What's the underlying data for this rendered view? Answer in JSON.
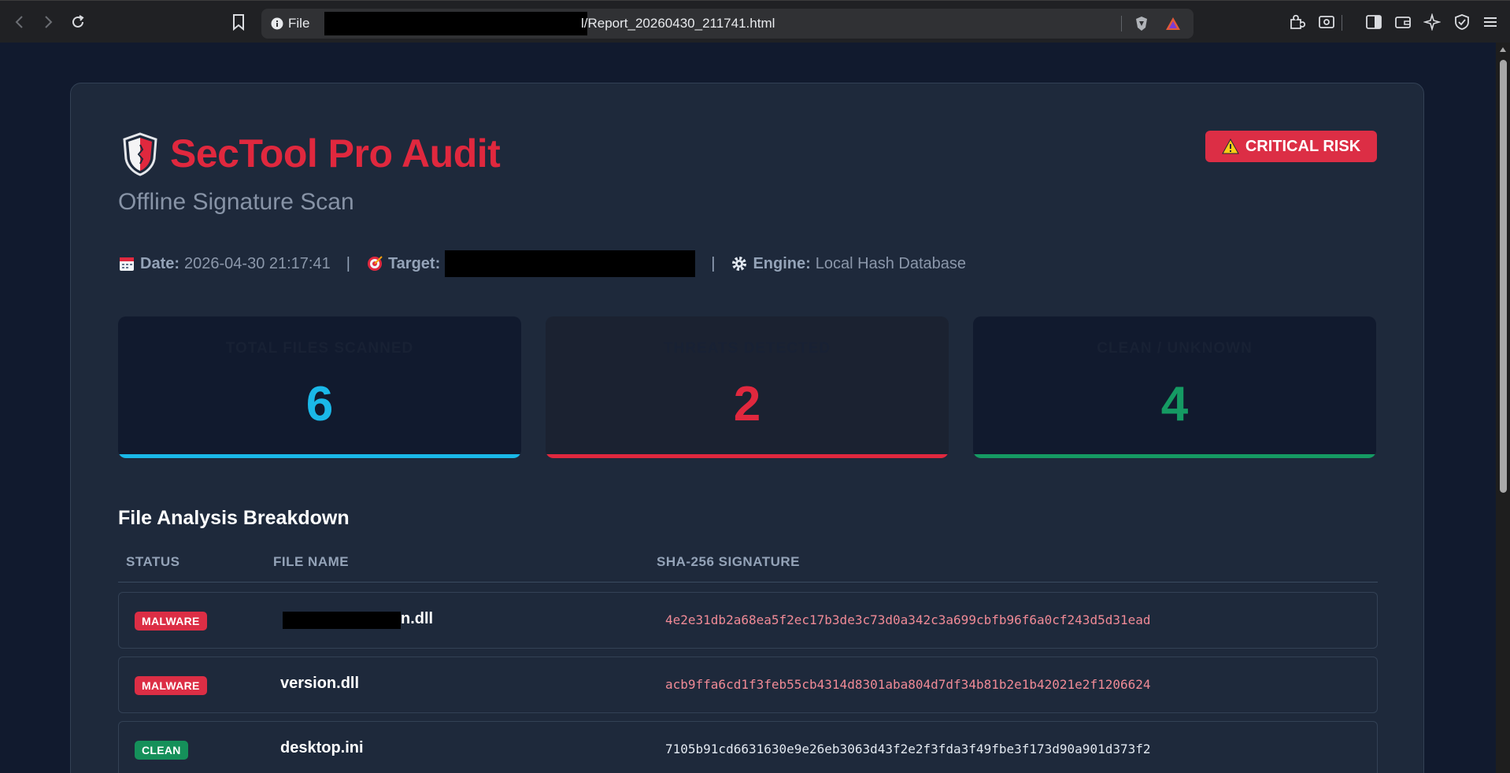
{
  "browser": {
    "url_scheme_label": "File",
    "url_visible": "l/Report_20260430_211741.html"
  },
  "report": {
    "title": "SecTool Pro Audit",
    "subtitle": "Offline Signature Scan",
    "risk_badge": "CRITICAL RISK",
    "meta": {
      "date_label": "Date:",
      "date_value": "2026-04-30 21:17:41",
      "target_label": "Target:",
      "engine_label": "Engine:",
      "engine_value": "Local Hash Database"
    },
    "stats": [
      {
        "label": "Total Files Scanned",
        "value": "6",
        "color": "#1ab8e8"
      },
      {
        "label": "Threats Detected",
        "value": "2",
        "color": "#e0283e"
      },
      {
        "label": "Clean / Unknown",
        "value": "4",
        "color": "#159a63"
      }
    ],
    "section_title": "File Analysis Breakdown",
    "table": {
      "headers": [
        "STATUS",
        "FILE NAME",
        "SHA-256 SIGNATURE"
      ],
      "rows": [
        {
          "status": "MALWARE",
          "status_color": "#dc2e45",
          "file_name": "n.dll",
          "name_redacted": true,
          "hash": "4e2e31db2a68ea5f2ec17b3de3c73d0a342c3a699cbfb96f6a0cf243d5d31ead",
          "hash_color": "#f08a96"
        },
        {
          "status": "MALWARE",
          "status_color": "#dc2e45",
          "file_name": "version.dll",
          "name_redacted": false,
          "hash": "acb9ffa6cd1f3feb55cb4314d8301aba804d7df34b81b2e1b42021e2f1206624",
          "hash_color": "#f08a96"
        },
        {
          "status": "CLEAN",
          "status_color": "#15905a",
          "file_name": "desktop.ini",
          "name_redacted": false,
          "hash": "7105b91cd6631630e9e26eb3063d43f2e2f3fda3f49fbe3f173d90a901d373f2",
          "hash_color": "#e2e8f0"
        }
      ]
    }
  }
}
